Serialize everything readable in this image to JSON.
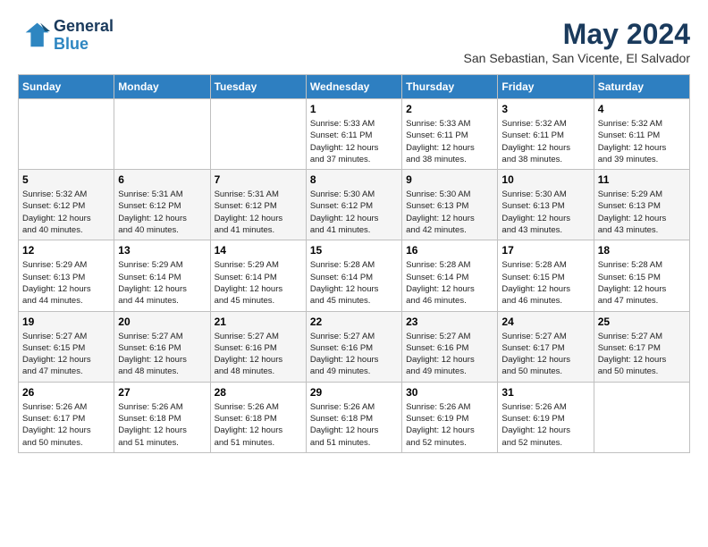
{
  "logo": {
    "line1": "General",
    "line2": "Blue"
  },
  "title": "May 2024",
  "location": "San Sebastian, San Vicente, El Salvador",
  "weekdays": [
    "Sunday",
    "Monday",
    "Tuesday",
    "Wednesday",
    "Thursday",
    "Friday",
    "Saturday"
  ],
  "weeks": [
    [
      {
        "day": null,
        "info": null
      },
      {
        "day": null,
        "info": null
      },
      {
        "day": null,
        "info": null
      },
      {
        "day": "1",
        "info": "Sunrise: 5:33 AM\nSunset: 6:11 PM\nDaylight: 12 hours\nand 37 minutes."
      },
      {
        "day": "2",
        "info": "Sunrise: 5:33 AM\nSunset: 6:11 PM\nDaylight: 12 hours\nand 38 minutes."
      },
      {
        "day": "3",
        "info": "Sunrise: 5:32 AM\nSunset: 6:11 PM\nDaylight: 12 hours\nand 38 minutes."
      },
      {
        "day": "4",
        "info": "Sunrise: 5:32 AM\nSunset: 6:11 PM\nDaylight: 12 hours\nand 39 minutes."
      }
    ],
    [
      {
        "day": "5",
        "info": "Sunrise: 5:32 AM\nSunset: 6:12 PM\nDaylight: 12 hours\nand 40 minutes."
      },
      {
        "day": "6",
        "info": "Sunrise: 5:31 AM\nSunset: 6:12 PM\nDaylight: 12 hours\nand 40 minutes."
      },
      {
        "day": "7",
        "info": "Sunrise: 5:31 AM\nSunset: 6:12 PM\nDaylight: 12 hours\nand 41 minutes."
      },
      {
        "day": "8",
        "info": "Sunrise: 5:30 AM\nSunset: 6:12 PM\nDaylight: 12 hours\nand 41 minutes."
      },
      {
        "day": "9",
        "info": "Sunrise: 5:30 AM\nSunset: 6:13 PM\nDaylight: 12 hours\nand 42 minutes."
      },
      {
        "day": "10",
        "info": "Sunrise: 5:30 AM\nSunset: 6:13 PM\nDaylight: 12 hours\nand 43 minutes."
      },
      {
        "day": "11",
        "info": "Sunrise: 5:29 AM\nSunset: 6:13 PM\nDaylight: 12 hours\nand 43 minutes."
      }
    ],
    [
      {
        "day": "12",
        "info": "Sunrise: 5:29 AM\nSunset: 6:13 PM\nDaylight: 12 hours\nand 44 minutes."
      },
      {
        "day": "13",
        "info": "Sunrise: 5:29 AM\nSunset: 6:14 PM\nDaylight: 12 hours\nand 44 minutes."
      },
      {
        "day": "14",
        "info": "Sunrise: 5:29 AM\nSunset: 6:14 PM\nDaylight: 12 hours\nand 45 minutes."
      },
      {
        "day": "15",
        "info": "Sunrise: 5:28 AM\nSunset: 6:14 PM\nDaylight: 12 hours\nand 45 minutes."
      },
      {
        "day": "16",
        "info": "Sunrise: 5:28 AM\nSunset: 6:14 PM\nDaylight: 12 hours\nand 46 minutes."
      },
      {
        "day": "17",
        "info": "Sunrise: 5:28 AM\nSunset: 6:15 PM\nDaylight: 12 hours\nand 46 minutes."
      },
      {
        "day": "18",
        "info": "Sunrise: 5:28 AM\nSunset: 6:15 PM\nDaylight: 12 hours\nand 47 minutes."
      }
    ],
    [
      {
        "day": "19",
        "info": "Sunrise: 5:27 AM\nSunset: 6:15 PM\nDaylight: 12 hours\nand 47 minutes."
      },
      {
        "day": "20",
        "info": "Sunrise: 5:27 AM\nSunset: 6:16 PM\nDaylight: 12 hours\nand 48 minutes."
      },
      {
        "day": "21",
        "info": "Sunrise: 5:27 AM\nSunset: 6:16 PM\nDaylight: 12 hours\nand 48 minutes."
      },
      {
        "day": "22",
        "info": "Sunrise: 5:27 AM\nSunset: 6:16 PM\nDaylight: 12 hours\nand 49 minutes."
      },
      {
        "day": "23",
        "info": "Sunrise: 5:27 AM\nSunset: 6:16 PM\nDaylight: 12 hours\nand 49 minutes."
      },
      {
        "day": "24",
        "info": "Sunrise: 5:27 AM\nSunset: 6:17 PM\nDaylight: 12 hours\nand 50 minutes."
      },
      {
        "day": "25",
        "info": "Sunrise: 5:27 AM\nSunset: 6:17 PM\nDaylight: 12 hours\nand 50 minutes."
      }
    ],
    [
      {
        "day": "26",
        "info": "Sunrise: 5:26 AM\nSunset: 6:17 PM\nDaylight: 12 hours\nand 50 minutes."
      },
      {
        "day": "27",
        "info": "Sunrise: 5:26 AM\nSunset: 6:18 PM\nDaylight: 12 hours\nand 51 minutes."
      },
      {
        "day": "28",
        "info": "Sunrise: 5:26 AM\nSunset: 6:18 PM\nDaylight: 12 hours\nand 51 minutes."
      },
      {
        "day": "29",
        "info": "Sunrise: 5:26 AM\nSunset: 6:18 PM\nDaylight: 12 hours\nand 51 minutes."
      },
      {
        "day": "30",
        "info": "Sunrise: 5:26 AM\nSunset: 6:19 PM\nDaylight: 12 hours\nand 52 minutes."
      },
      {
        "day": "31",
        "info": "Sunrise: 5:26 AM\nSunset: 6:19 PM\nDaylight: 12 hours\nand 52 minutes."
      },
      {
        "day": null,
        "info": null
      }
    ]
  ]
}
